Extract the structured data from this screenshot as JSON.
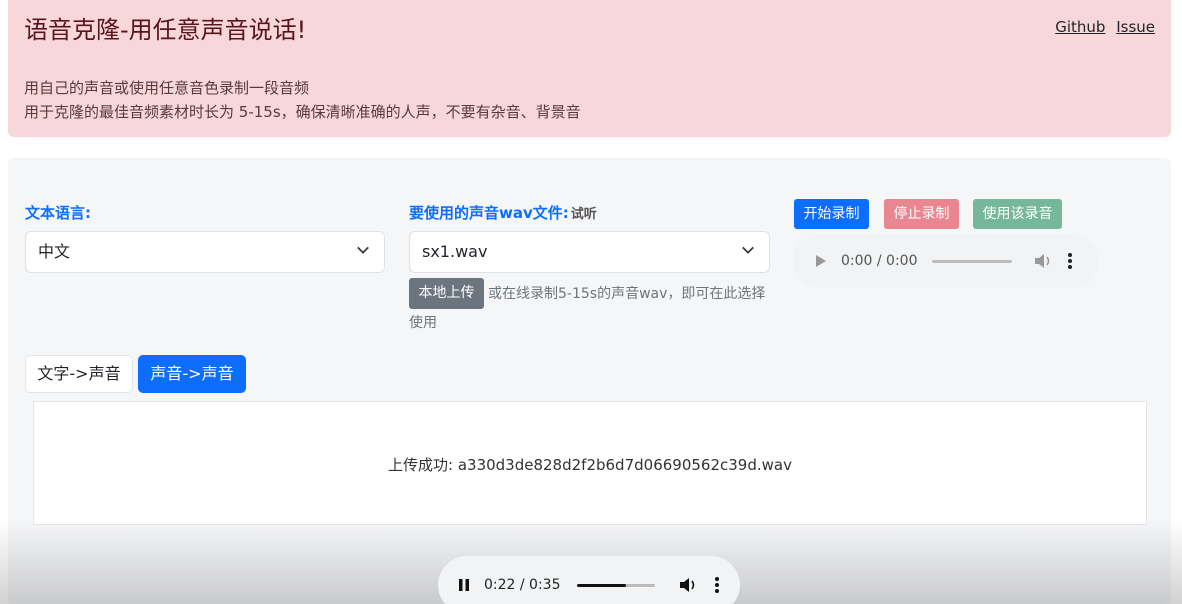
{
  "header": {
    "title": "语音克隆-用任意声音说话!",
    "links": [
      "Github",
      "Issue"
    ],
    "desc_line1": "用自己的声音或使用任意音色录制一段音频",
    "desc_line2": "用于克隆的最佳音频素材时长为 5-15s，确保清晰准确的人声，不要有杂音、背景音"
  },
  "form": {
    "lang_label": "文本语言:",
    "lang_value": "中文",
    "voice_label": "要使用的声音wav文件:",
    "voice_preview": "试听",
    "voice_value": "sx1.wav",
    "upload_button": "本地上传",
    "upload_hint_line1": "或在线录制5-15s的声音wav，即可在此选择",
    "upload_hint_line2": "使用"
  },
  "record": {
    "start": "开始录制",
    "stop": "停止录制",
    "use": "使用该录音",
    "time": "0:00 / 0:00"
  },
  "tabs": {
    "text_to_speech": "文字->声音",
    "speech_to_speech": "声音->声音"
  },
  "result": {
    "message": "上传成功: a330d3de828d2f2b6d7d06690562c39d.wav"
  },
  "player": {
    "time": "0:22 / 0:35",
    "progress": 0.63
  },
  "colors": {
    "primary": "#0d6efd",
    "danger_light": "#ea868f",
    "success_light": "#75b798",
    "secondary": "#6c757d",
    "alert_bg": "#f8d7da"
  }
}
